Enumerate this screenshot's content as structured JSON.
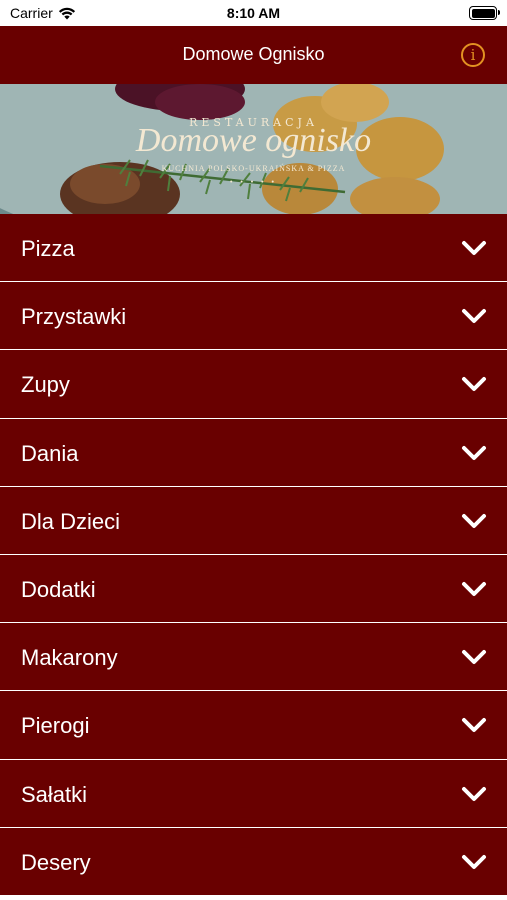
{
  "status_bar": {
    "carrier": "Carrier",
    "time": "8:10 AM"
  },
  "nav": {
    "title": "Domowe Ognisko",
    "info_icon": "info-icon"
  },
  "banner": {
    "overline": "RESTAURACJA",
    "name": "Domowe ognisko",
    "subtitle": "KUCHNIA POLSKO-UKRAIŃSKA & PIZZA"
  },
  "menu": {
    "items": [
      {
        "label": "Pizza"
      },
      {
        "label": "Przystawki"
      },
      {
        "label": "Zupy"
      },
      {
        "label": "Dania"
      },
      {
        "label": "Dla Dzieci"
      },
      {
        "label": "Dodatki"
      },
      {
        "label": "Makarony"
      },
      {
        "label": "Pierogi"
      },
      {
        "label": "Sałatki"
      },
      {
        "label": "Desery"
      }
    ]
  },
  "colors": {
    "brand": "#690000",
    "accent": "#e39222",
    "text": "#ffffff"
  }
}
